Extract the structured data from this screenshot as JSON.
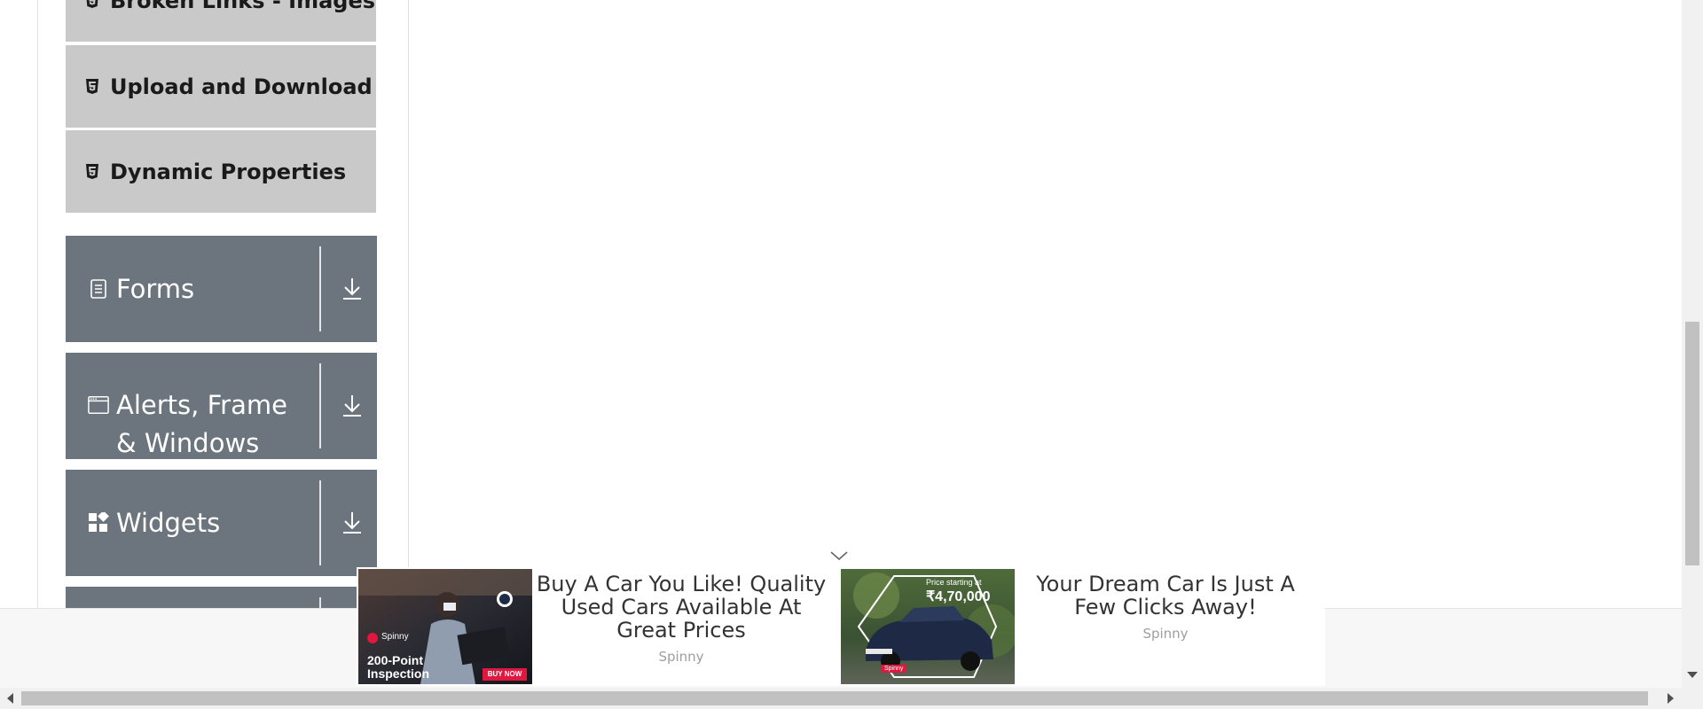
{
  "sidebar": {
    "items": [
      {
        "label": "Broken Links - Images",
        "icon": "html5-icon"
      },
      {
        "label": "Upload and Download",
        "icon": "html5-icon"
      },
      {
        "label": "Dynamic Properties",
        "icon": "html5-icon"
      }
    ],
    "groups": [
      {
        "label": "Forms",
        "icon": "form-icon"
      },
      {
        "label": "Alerts, Frame & Windows",
        "icon": "window-icon"
      },
      {
        "label": "Widgets",
        "icon": "widgets-icon"
      }
    ]
  },
  "ads": [
    {
      "headline": "Buy A Car You Like! Quality Used Cars Available At Great Prices",
      "brand": "Spinny",
      "image": {
        "logo": "Spinny",
        "caption_line1": "200-Point",
        "caption_line2": "Inspection",
        "cta": "BUY NOW"
      }
    },
    {
      "headline": "Your Dream Car Is Just A Few Clicks Away!",
      "brand": "Spinny",
      "image": {
        "price_label": "Price starting at",
        "price": "₹4,70,000",
        "logo": "Spinny"
      }
    }
  ],
  "colors": {
    "group_bg": "#6c757d",
    "item_bg": "#c9c9c9",
    "cta": "#e0173f"
  }
}
